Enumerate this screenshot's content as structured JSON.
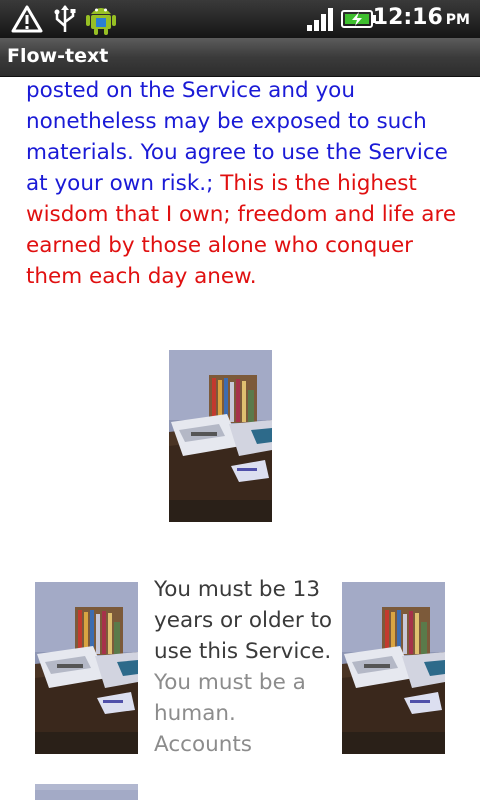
{
  "status_bar": {
    "time": "12:16",
    "ampm": "PM",
    "icons": [
      "warning-icon",
      "usb-icon",
      "android-icon",
      "signal-icon",
      "battery-charging-icon"
    ]
  },
  "app": {
    "title": "Flow-text"
  },
  "paragraph": {
    "blue_text": "posted on the Service and you nonetheless may be exposed to such materials. You agree to use the Service at your own risk.;",
    "red_text": "This is the highest wisdom that I own; freedom and life are earned by those alone who conquer them each day anew."
  },
  "flow": {
    "dark_text": "You must be 13 years or older to use this Service.",
    "grey_text": "You must be a human. Accounts"
  },
  "colors": {
    "link_blue": "#1a1ad6",
    "quote_red": "#e01010",
    "body_text": "#3a3a3a",
    "muted_text": "#8c8c8c"
  }
}
